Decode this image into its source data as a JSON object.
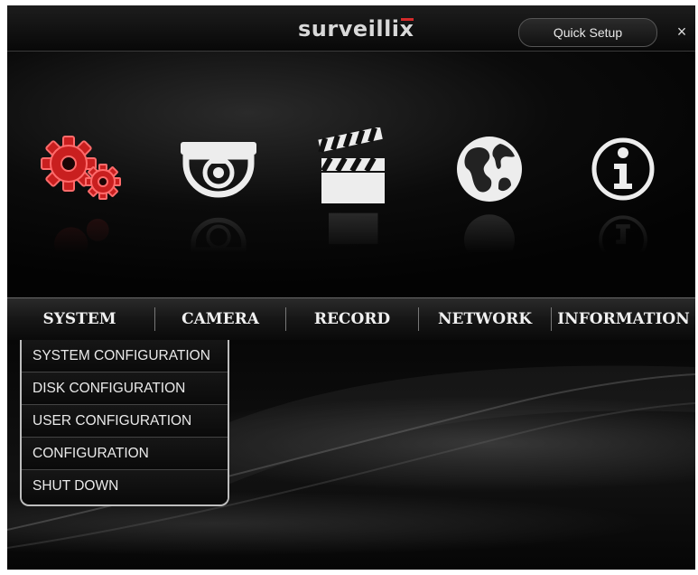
{
  "header": {
    "logo_text": "surveillix",
    "quick_setup_label": "Quick Setup",
    "close_label": "×"
  },
  "menu_icons": [
    {
      "name": "settings-gears-icon",
      "color": "#d42a2a"
    },
    {
      "name": "dome-camera-icon",
      "color": "#e6e6e6"
    },
    {
      "name": "clapperboard-icon",
      "color": "#e6e6e6"
    },
    {
      "name": "globe-icon",
      "color": "#e6e6e6"
    },
    {
      "name": "info-icon",
      "color": "#e6e6e6"
    }
  ],
  "nav": {
    "items": [
      {
        "label": "SYSTEM"
      },
      {
        "label": "CAMERA"
      },
      {
        "label": "RECORD"
      },
      {
        "label": "NETWORK"
      },
      {
        "label": "INFORMATION"
      }
    ]
  },
  "system_menu": {
    "items": [
      {
        "label": "SYSTEM CONFIGURATION"
      },
      {
        "label": "DISK CONFIGURATION"
      },
      {
        "label": "USER CONFIGURATION"
      },
      {
        "label": "CONFIGURATION"
      },
      {
        "label": "SHUT DOWN"
      }
    ]
  }
}
